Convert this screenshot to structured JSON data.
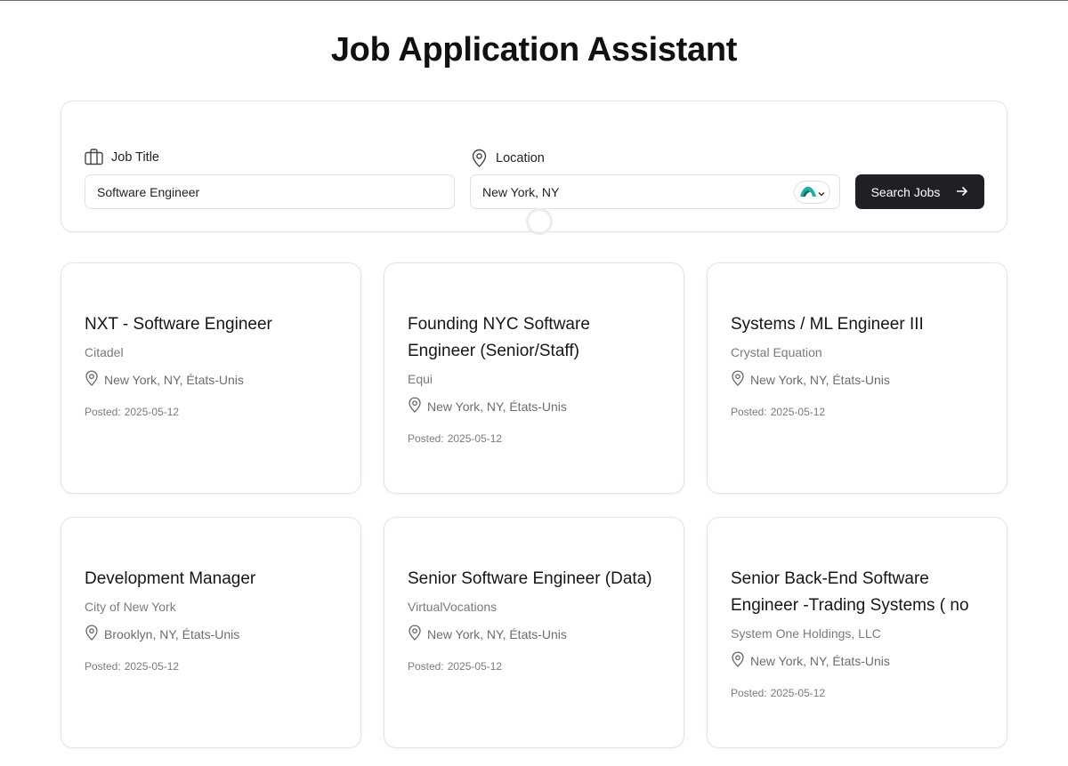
{
  "header": {
    "title": "Job Application Assistant"
  },
  "search": {
    "job_title_label": "Job Title",
    "job_title_value": "Software Engineer",
    "location_label": "Location",
    "location_value": "New York, NY",
    "button_label": "Search Jobs"
  },
  "colors": {
    "button_bg": "#1f2023",
    "extension_accent": "#1bb1a3"
  },
  "posted_label": "Posted:",
  "jobs": [
    {
      "title": "NXT - Software Engineer",
      "company": "Citadel",
      "location": "New York, NY, États-Unis",
      "posted": "2025-05-12"
    },
    {
      "title": "Founding NYC Software Engineer (Senior/Staff)",
      "company": "Equi",
      "location": "New York, NY, États-Unis",
      "posted": "2025-05-12"
    },
    {
      "title": "Systems / ML Engineer III",
      "company": "Crystal Equation",
      "location": "New York, NY, États-Unis",
      "posted": "2025-05-12"
    },
    {
      "title": "Development Manager",
      "company": "City of New York",
      "location": "Brooklyn, NY, États-Unis",
      "posted": "2025-05-12"
    },
    {
      "title": "Senior Software Engineer (Data)",
      "company": "VirtualVocations",
      "location": "New York, NY, États-Unis",
      "posted": "2025-05-12"
    },
    {
      "title": "Senior Back-End Software Engineer -Trading Systems ( no",
      "company": "System One Holdings, LLC",
      "location": "New York, NY, États-Unis",
      "posted": "2025-05-12"
    }
  ]
}
